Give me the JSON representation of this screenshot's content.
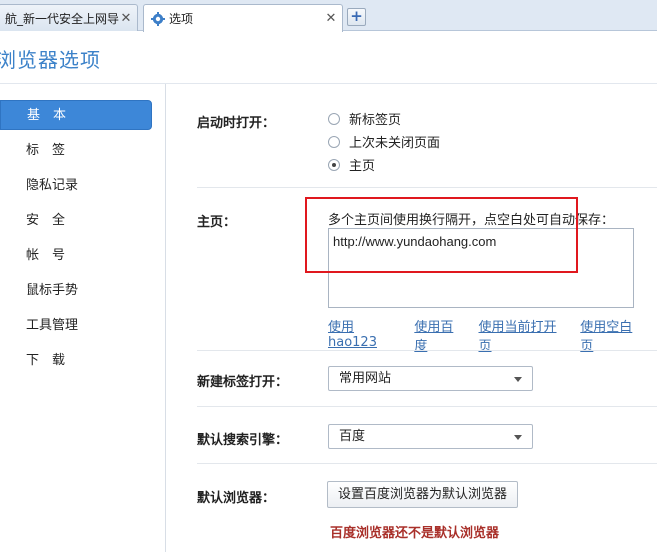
{
  "tabs": [
    {
      "title": "航_新一代安全上网导",
      "close": "✕"
    },
    {
      "title": "选项",
      "close": "✕"
    }
  ],
  "new_tab_label": "+",
  "page_title": "浏览器选项",
  "sidebar": {
    "items": [
      {
        "label": "基　本",
        "active": true
      },
      {
        "label": "标　签"
      },
      {
        "label": "隐私记录"
      },
      {
        "label": "安　全"
      },
      {
        "label": "帐　号"
      },
      {
        "label": "鼠标手势"
      },
      {
        "label": "工具管理"
      },
      {
        "label": "下　载"
      }
    ]
  },
  "startup": {
    "label": "启动时打开：",
    "options": [
      "新标签页",
      "上次未关闭页面",
      "主页"
    ],
    "selected": "主页"
  },
  "homepage": {
    "label": "主页：",
    "hint": "多个主页间使用换行隔开，点空白处可自动保存：",
    "value": "http://www.yundaohang.com",
    "links": [
      "使用hao123",
      "使用百度",
      "使用当前打开页",
      "使用空白页"
    ]
  },
  "new_tab": {
    "label": "新建标签打开：",
    "value": "常用网站"
  },
  "search_engine": {
    "label": "默认搜索引擎：",
    "value": "百度"
  },
  "default_browser": {
    "label": "默认浏览器：",
    "button": "设置百度浏览器为默认浏览器",
    "status": "百度浏览器还不是默认浏览器"
  },
  "colors": {
    "accent": "#3d87d8",
    "highlight": "#e0181e",
    "warning": "#a9302a"
  }
}
